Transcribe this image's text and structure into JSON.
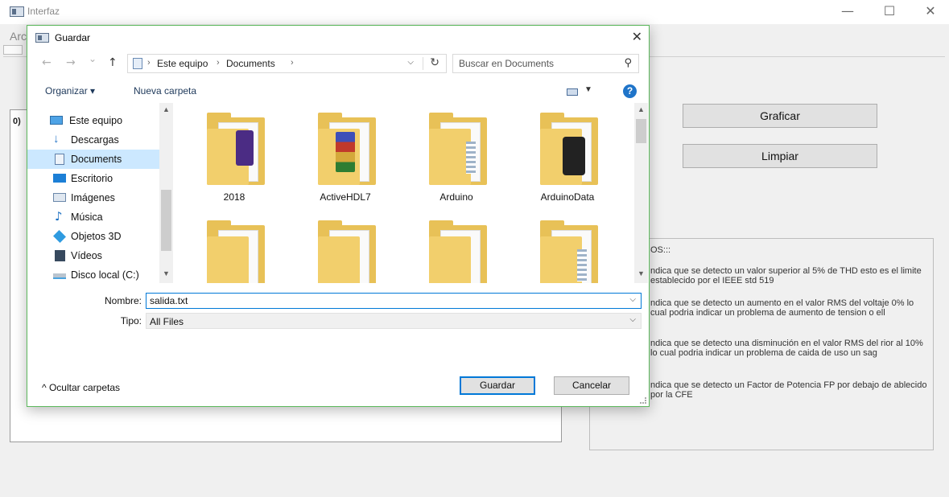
{
  "app": {
    "title": "Interfaz",
    "menu_stub": "Arc",
    "minimize_glyph": "—",
    "maximize_glyph": "☐",
    "close_glyph": "✕",
    "list_text": "0)",
    "buttons": {
      "plot": "Graficar",
      "clear": "Limpiar"
    },
    "notes": {
      "title": "OS:::",
      "items": [
        "ndica que se detecto un valor superior al 5% de THD esto es el limite establecido por el IEEE std 519",
        "ndica que se detecto un aumento en el valor RMS del voltaje 0% lo cual podria indicar un problema de aumento de tension o ell",
        "ndica que se detecto una disminución en el valor RMS del rior al 10% lo cual podria indicar un problema de caida de uso un sag",
        "ndica que se detecto un Factor de Potencia FP por debajo de ablecido por la CFE"
      ]
    }
  },
  "dialog": {
    "title": "Guardar",
    "close_glyph": "✕",
    "nav": {
      "back": "←",
      "forward": "→",
      "recent": "⌄",
      "up": "↑"
    },
    "breadcrumb": [
      "Este equipo",
      "Documents"
    ],
    "breadcrumb_sep": "›",
    "search": {
      "placeholder": "Buscar en Documents"
    },
    "commands": {
      "organize": "Organizar ▾",
      "new_folder": "Nueva carpeta",
      "help": "?"
    },
    "nav_pane": [
      {
        "label": "Este equipo",
        "icon": "computer-icon"
      },
      {
        "label": "Descargas",
        "icon": "downloads-icon"
      },
      {
        "label": "Documents",
        "icon": "documents-icon",
        "selected": true
      },
      {
        "label": "Escritorio",
        "icon": "desktop-icon"
      },
      {
        "label": "Imágenes",
        "icon": "pictures-icon"
      },
      {
        "label": "Música",
        "icon": "music-icon"
      },
      {
        "label": "Objetos 3D",
        "icon": "objects3d-icon"
      },
      {
        "label": "Vídeos",
        "icon": "videos-icon"
      },
      {
        "label": "Disco local (C:)",
        "icon": "drive-icon"
      }
    ],
    "files": [
      {
        "name": "2018"
      },
      {
        "name": "ActiveHDL7"
      },
      {
        "name": "Arduino"
      },
      {
        "name": "ArduinoData"
      },
      {
        "name": ""
      },
      {
        "name": ""
      },
      {
        "name": ""
      },
      {
        "name": ""
      }
    ],
    "form": {
      "name_label": "Nombre:",
      "name_value": "salida.txt",
      "type_label": "Tipo:",
      "type_value": "All Files"
    },
    "hide_folders": "^  Ocultar carpetas",
    "buttons": {
      "save": "Guardar",
      "cancel": "Cancelar"
    }
  },
  "colors": {
    "selection": "#cce8ff",
    "accent": "#0078d7",
    "dialog_border": "#5cb85c",
    "folder": "#e8c157"
  }
}
